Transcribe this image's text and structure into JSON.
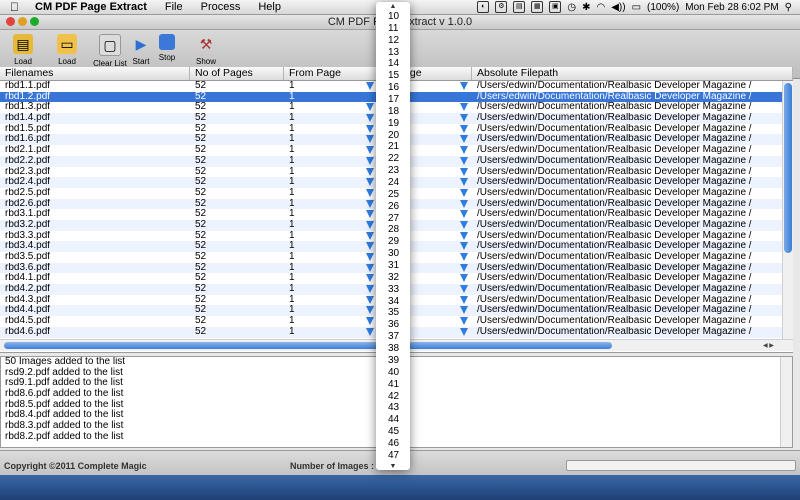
{
  "menubar": {
    "app_name": "CM PDF Page Extract",
    "menus": [
      "File",
      "Process",
      "Help"
    ],
    "battery": "(100%)",
    "clock": "Mon Feb 28  6:02 PM"
  },
  "window": {
    "title": "CM PDF Page Extract v 1.0.0"
  },
  "toolbar": {
    "load_files": "Load Files",
    "load_folders": "Load Folders",
    "clear_list": "Clear List",
    "start": "Start",
    "stop": "Stop",
    "show_settings": "Show Settings"
  },
  "table": {
    "columns": [
      "Filenames",
      "No of Pages",
      "From Page",
      "To Page",
      "Absolute Filepath"
    ],
    "rows": [
      {
        "name": "rbd1.1.pdf",
        "pages": "52",
        "from": "1",
        "path": "/Users/edwin/Documentation/Realbasic Developer Magazine /"
      },
      {
        "name": "rbd1.2.pdf",
        "pages": "52",
        "from": "1",
        "path": "/Users/edwin/Documentation/Realbasic Developer Magazine /"
      },
      {
        "name": "rbd1.3.pdf",
        "pages": "52",
        "from": "1",
        "path": "/Users/edwin/Documentation/Realbasic Developer Magazine /"
      },
      {
        "name": "rbd1.4.pdf",
        "pages": "52",
        "from": "1",
        "path": "/Users/edwin/Documentation/Realbasic Developer Magazine /"
      },
      {
        "name": "rbd1.5.pdf",
        "pages": "52",
        "from": "1",
        "path": "/Users/edwin/Documentation/Realbasic Developer Magazine /"
      },
      {
        "name": "rbd1.6.pdf",
        "pages": "52",
        "from": "1",
        "path": "/Users/edwin/Documentation/Realbasic Developer Magazine /"
      },
      {
        "name": "rbd2.1.pdf",
        "pages": "52",
        "from": "1",
        "path": "/Users/edwin/Documentation/Realbasic Developer Magazine /"
      },
      {
        "name": "rbd2.2.pdf",
        "pages": "52",
        "from": "1",
        "path": "/Users/edwin/Documentation/Realbasic Developer Magazine /"
      },
      {
        "name": "rbd2.3.pdf",
        "pages": "52",
        "from": "1",
        "path": "/Users/edwin/Documentation/Realbasic Developer Magazine /"
      },
      {
        "name": "rbd2.4.pdf",
        "pages": "52",
        "from": "1",
        "path": "/Users/edwin/Documentation/Realbasic Developer Magazine /"
      },
      {
        "name": "rbd2.5.pdf",
        "pages": "52",
        "from": "1",
        "path": "/Users/edwin/Documentation/Realbasic Developer Magazine /"
      },
      {
        "name": "rbd2.6.pdf",
        "pages": "52",
        "from": "1",
        "path": "/Users/edwin/Documentation/Realbasic Developer Magazine /"
      },
      {
        "name": "rbd3.1.pdf",
        "pages": "52",
        "from": "1",
        "path": "/Users/edwin/Documentation/Realbasic Developer Magazine /"
      },
      {
        "name": "rbd3.2.pdf",
        "pages": "52",
        "from": "1",
        "path": "/Users/edwin/Documentation/Realbasic Developer Magazine /"
      },
      {
        "name": "rbd3.3.pdf",
        "pages": "52",
        "from": "1",
        "path": "/Users/edwin/Documentation/Realbasic Developer Magazine /"
      },
      {
        "name": "rbd3.4.pdf",
        "pages": "52",
        "from": "1",
        "path": "/Users/edwin/Documentation/Realbasic Developer Magazine /"
      },
      {
        "name": "rbd3.5.pdf",
        "pages": "52",
        "from": "1",
        "path": "/Users/edwin/Documentation/Realbasic Developer Magazine /"
      },
      {
        "name": "rbd3.6.pdf",
        "pages": "52",
        "from": "1",
        "path": "/Users/edwin/Documentation/Realbasic Developer Magazine /"
      },
      {
        "name": "rbd4.1.pdf",
        "pages": "52",
        "from": "1",
        "path": "/Users/edwin/Documentation/Realbasic Developer Magazine /"
      },
      {
        "name": "rbd4.2.pdf",
        "pages": "52",
        "from": "1",
        "path": "/Users/edwin/Documentation/Realbasic Developer Magazine /"
      },
      {
        "name": "rbd4.3.pdf",
        "pages": "52",
        "from": "1",
        "path": "/Users/edwin/Documentation/Realbasic Developer Magazine /"
      },
      {
        "name": "rbd4.4.pdf",
        "pages": "52",
        "from": "1",
        "path": "/Users/edwin/Documentation/Realbasic Developer Magazine /"
      },
      {
        "name": "rbd4.5.pdf",
        "pages": "52",
        "from": "1",
        "path": "/Users/edwin/Documentation/Realbasic Developer Magazine /"
      },
      {
        "name": "rbd4.6.pdf",
        "pages": "52",
        "from": "1",
        "path": "/Users/edwin/Documentation/Realbasic Developer Magazine /"
      }
    ],
    "selected_index": 1
  },
  "log": {
    "lines": [
      "50 Images added to the list",
      "rsd9.2.pdf added to the list",
      "rsd9.1.pdf added to the list",
      "rbd8.6.pdf added to the list",
      "rbd8.5.pdf added to the list",
      "rbd8.4.pdf added to the list",
      "rbd8.3.pdf added to the list",
      "rbd8.2.pdf added to the list"
    ]
  },
  "status": {
    "copyright": "Copyright ©2011 Complete Magic",
    "count_label": "Number of Images : 50"
  },
  "popup": {
    "options": [
      "10",
      "11",
      "12",
      "13",
      "14",
      "15",
      "16",
      "17",
      "18",
      "19",
      "20",
      "21",
      "22",
      "23",
      "24",
      "25",
      "26",
      "27",
      "28",
      "29",
      "30",
      "31",
      "32",
      "33",
      "34",
      "35",
      "36",
      "37",
      "38",
      "39",
      "40",
      "41",
      "42",
      "43",
      "44",
      "45",
      "46",
      "47"
    ]
  },
  "colors": {
    "selection": "#3875d7",
    "arrow": "#2f7de0",
    "stripe": "#edf3fe"
  }
}
